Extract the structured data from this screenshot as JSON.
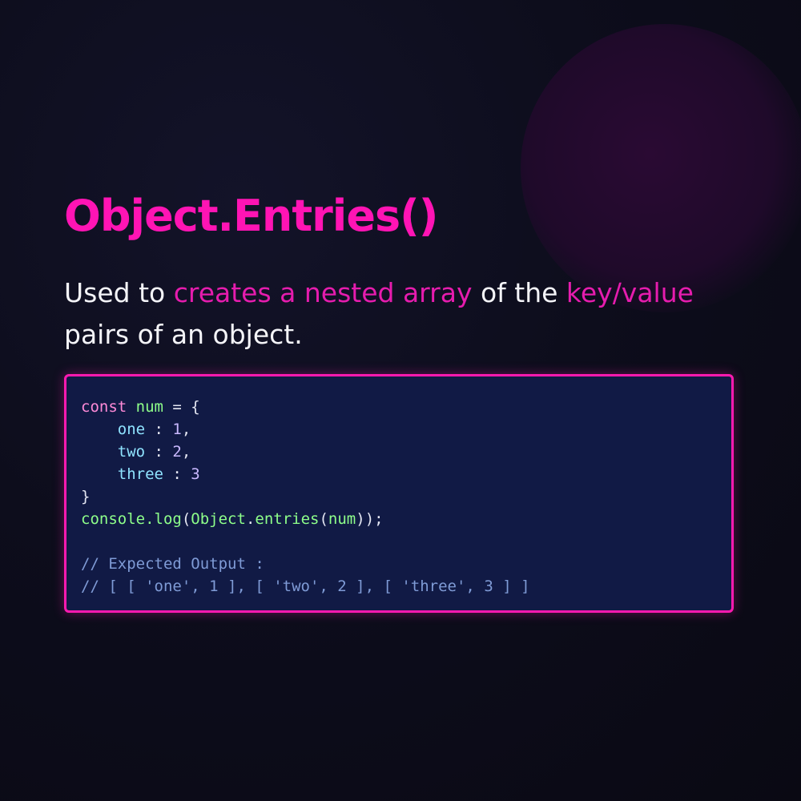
{
  "title": "Object.Entries()",
  "description": {
    "part1": "Used to ",
    "highlight1": "creates a nested array",
    "part2": " of the ",
    "highlight2": "key/value",
    "part3": " pairs of an object."
  },
  "code": {
    "line1": {
      "kw": "const",
      "sp1": " ",
      "name": "num",
      "rest": " = {"
    },
    "line2": {
      "indent": "    ",
      "key": "one",
      "sep": " : ",
      "val": "1",
      "end": ","
    },
    "line3": {
      "indent": "    ",
      "key": "two",
      "sep": " : ",
      "val": "2",
      "end": ","
    },
    "line4": {
      "indent": "    ",
      "key": "three",
      "sep": " : ",
      "val": "3"
    },
    "line5": "}",
    "line6": {
      "fn1": "console.log",
      "p1": "(",
      "fn2": "Object",
      "dot": ".",
      "fn3": "entries",
      "p2": "(",
      "arg": "num",
      "p3": "));"
    },
    "line7": "",
    "comment1": "// Expected Output :",
    "comment2": "// [ [ 'one', 1 ], [ 'two', 2 ], [ 'three', 3 ] ]"
  },
  "colors": {
    "accent": "#ff14b4",
    "code_background": "#111a45",
    "border": "#ff1ab0"
  }
}
